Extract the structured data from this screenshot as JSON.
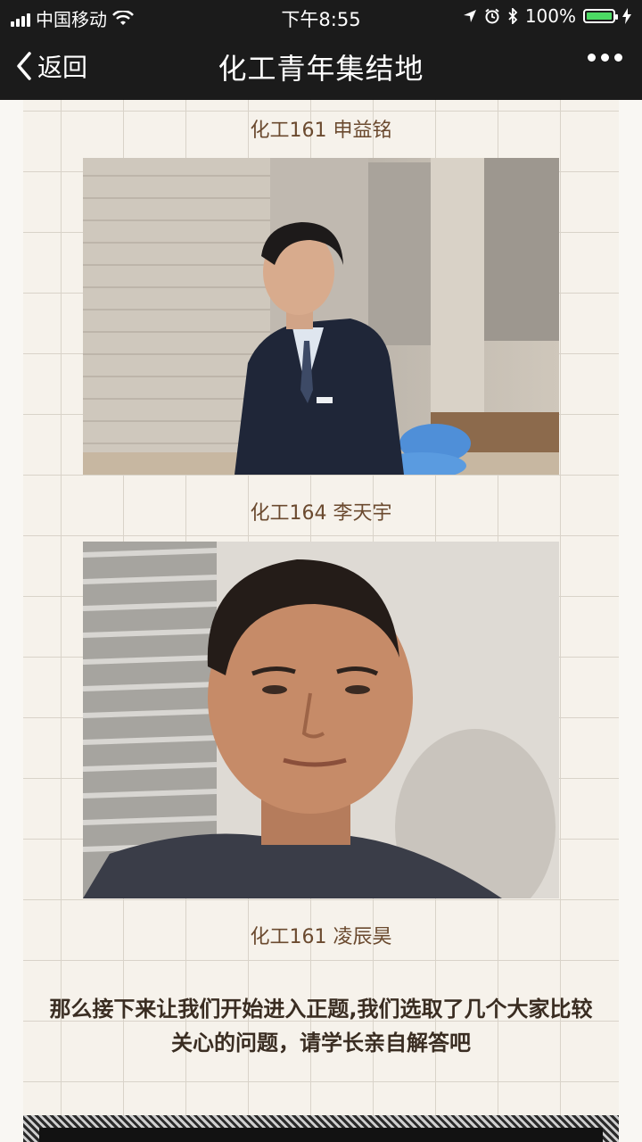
{
  "status_bar": {
    "carrier": "中国移动",
    "time": "下午8:55",
    "battery_text": "100%",
    "battery_level": 1.0
  },
  "nav": {
    "back_label": "返回",
    "title": "化工青年集结地"
  },
  "content": {
    "captions": [
      "化工161 申益铭",
      "化工164  李天宇",
      "化工161  凌辰昊"
    ],
    "paragraph": "那么接下来让我们开始进入正题,我们选取了几个大家比较关心的问题，请学长亲自解答吧"
  },
  "colors": {
    "caption": "#6b4a2f",
    "bar_bg": "#1b1b1b",
    "grid_bg": "#f6f2eb",
    "battery": "#4cd964"
  }
}
